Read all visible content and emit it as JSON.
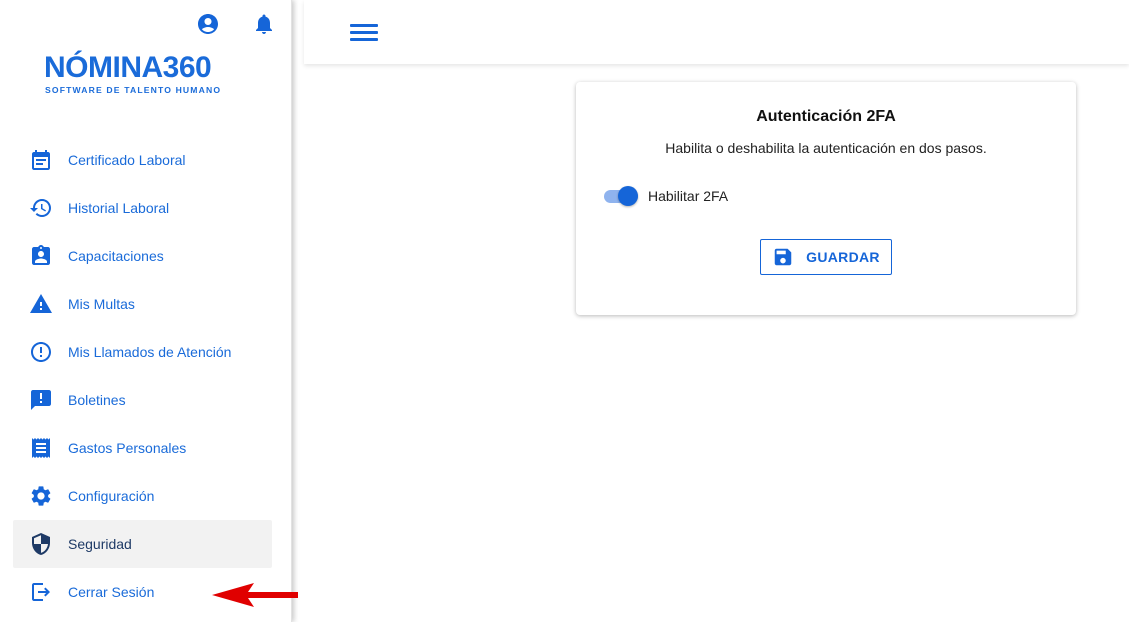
{
  "brand": {
    "name": "NÓMINA360",
    "tagline": "SOFTWARE DE TALENTO HUMANO"
  },
  "header_icons": [
    "account-circle-icon",
    "bell-icon"
  ],
  "sidebar": {
    "items": [
      {
        "label": "Certificado Laboral",
        "icon": "calendar-icon"
      },
      {
        "label": "Historial Laboral",
        "icon": "history-icon"
      },
      {
        "label": "Capacitaciones",
        "icon": "clipboard-account-icon"
      },
      {
        "label": "Mis Multas",
        "icon": "warning-icon"
      },
      {
        "label": "Mis Llamados de Atención",
        "icon": "alert-circle-icon"
      },
      {
        "label": "Boletines",
        "icon": "announcement-icon"
      },
      {
        "label": "Gastos Personales",
        "icon": "receipt-icon"
      },
      {
        "label": "Configuración",
        "icon": "gear-icon"
      },
      {
        "label": "Seguridad",
        "icon": "shield-icon"
      },
      {
        "label": "Cerrar Sesión",
        "icon": "logout-icon"
      }
    ],
    "active_item": "Seguridad"
  },
  "card": {
    "title": "Autenticación 2FA",
    "description": "Habilita o deshabilita la autenticación en dos pasos.",
    "toggle_label": "Habilitar 2FA",
    "toggle_on": true,
    "save_label": "GUARDAR"
  },
  "colors": {
    "accent": "#1565d8",
    "active_text": "#1e3a66",
    "active_bg": "#f2f2f2",
    "arrow": "#e00000"
  }
}
